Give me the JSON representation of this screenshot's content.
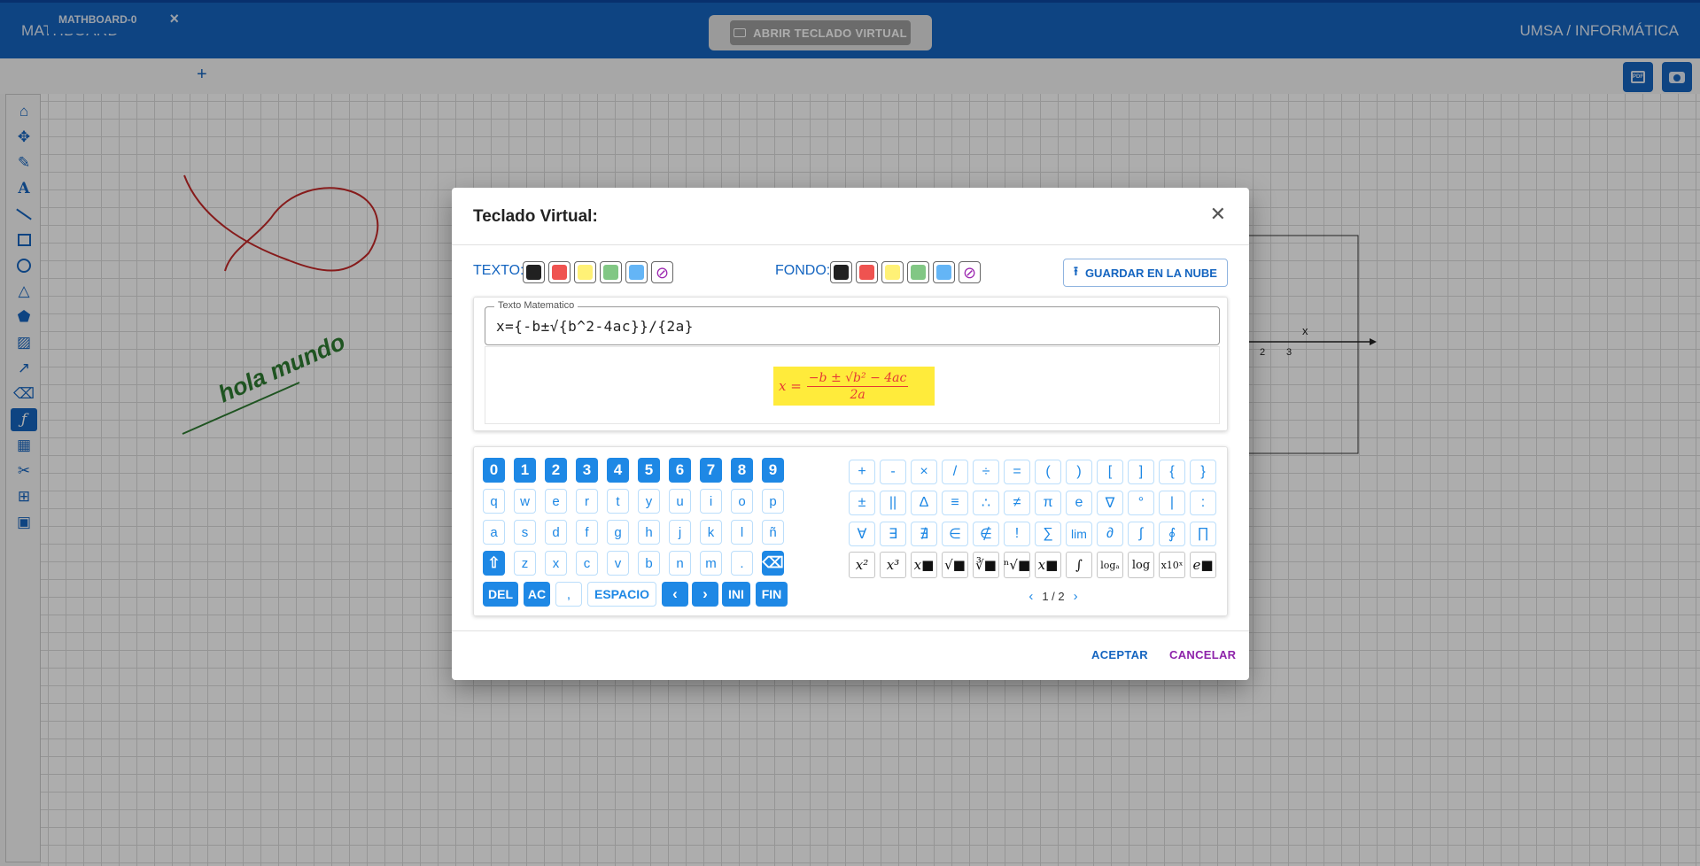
{
  "app": {
    "brand": "MATHBOARD",
    "org": "UMSA / INFORMÁTICA",
    "open_keyboard_label": "ABRIR TECLADO VIRTUAL"
  },
  "tabs": [
    {
      "label": "MATHBOARD-0"
    }
  ],
  "toolbar_icons": [
    "home-icon",
    "move-icon",
    "pencil-icon",
    "text-icon",
    "line-icon",
    "rectangle-icon",
    "circle-icon",
    "triangle-icon",
    "pentagon-icon",
    "image-icon",
    "chart-icon",
    "eraser-icon",
    "formula-icon",
    "calculator-icon",
    "scissors-icon",
    "table-icon",
    "save-icon"
  ],
  "canvas": {
    "handwritten_text": "hola mundo",
    "axis_label_x": "x",
    "tick_2": "2",
    "tick_3": "3"
  },
  "modal": {
    "title": "Teclado Virtual:",
    "text_label": "TEXTO:",
    "background_label": "FONDO:",
    "swatch_colors": [
      "#212121",
      "#ef5350",
      "#fff176",
      "#81c784",
      "#64b5f6",
      "none"
    ],
    "save_cloud_label": "GUARDAR EN LA NUBE",
    "input_legend": "Texto Matematico",
    "input_value": "x={-b±√{b^2-4ac}}/{2a}",
    "formula": {
      "lhs": "x =",
      "numerator": "−b ± √b² − 4ac",
      "denominator": "2a",
      "text_color": "#e53935",
      "bg_color": "#ffeb3b"
    },
    "accept_label": "ACEPTAR",
    "cancel_label": "CANCELAR"
  },
  "keyboard": {
    "digits": [
      "0",
      "1",
      "2",
      "3",
      "4",
      "5",
      "6",
      "7",
      "8",
      "9"
    ],
    "row1": [
      "q",
      "w",
      "e",
      "r",
      "t",
      "y",
      "u",
      "i",
      "o",
      "p"
    ],
    "row2": [
      "a",
      "s",
      "d",
      "f",
      "g",
      "h",
      "j",
      "k",
      "l",
      "ñ"
    ],
    "row3": [
      "z",
      "x",
      "c",
      "v",
      "b",
      "n",
      "m",
      "."
    ],
    "bottom": {
      "del": "DEL",
      "ac": "AC",
      "comma": ",",
      "space": "ESPACIO",
      "left": "‹",
      "right": "›",
      "home": "INI",
      "end": "FIN"
    },
    "shift": "⇧",
    "backspace": "⌫",
    "symbols_row1": [
      "+",
      "-",
      "×",
      "/",
      "÷",
      "=",
      "(",
      ")",
      "[",
      "]",
      "{",
      "}"
    ],
    "symbols_row2": [
      "±",
      "||",
      "Δ",
      "≡",
      "∴",
      "≠",
      "π",
      "e",
      "∇",
      "°",
      "|",
      ":"
    ],
    "symbols_row3": [
      "∀",
      "∃",
      "∄",
      "∈",
      "∉",
      "!",
      "∑",
      "lim",
      "∂",
      "∫",
      "∮",
      "∏"
    ],
    "templates": [
      "x²",
      "x³",
      "x■",
      "√■",
      "∛■",
      "ⁿ√■",
      "x■",
      "∫",
      "logₐ",
      "log",
      "x10ˣ",
      "e■"
    ],
    "page": "1 / 2"
  }
}
